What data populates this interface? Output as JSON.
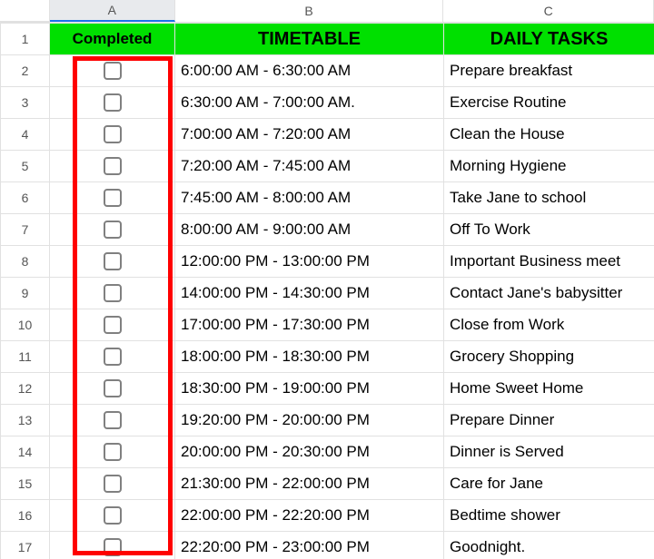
{
  "colLabels": {
    "A": "A",
    "B": "B",
    "C": "C"
  },
  "header": {
    "a": "Completed",
    "b": "TIMETABLE",
    "c": "DAILY TASKS"
  },
  "rows": [
    {
      "n": "1"
    },
    {
      "n": "2",
      "time": "6:00:00 AM - 6:30:00 AM",
      "task": "Prepare breakfast"
    },
    {
      "n": "3",
      "time": "6:30:00 AM - 7:00:00 AM.",
      "task": "Exercise Routine"
    },
    {
      "n": "4",
      "time": "7:00:00 AM - 7:20:00 AM",
      "task": "Clean the House"
    },
    {
      "n": "5",
      "time": "7:20:00 AM - 7:45:00 AM",
      "task": "Morning Hygiene"
    },
    {
      "n": "6",
      "time": "7:45:00 AM - 8:00:00 AM",
      "task": "Take Jane to school"
    },
    {
      "n": "7",
      "time": "8:00:00 AM - 9:00:00 AM",
      "task": "Off To Work"
    },
    {
      "n": "8",
      "time": "12:00:00 PM - 13:00:00 PM",
      "task": "Important Business meet"
    },
    {
      "n": "9",
      "time": "14:00:00 PM - 14:30:00 PM",
      "task": "Contact Jane's babysitter"
    },
    {
      "n": "10",
      "time": "17:00:00 PM - 17:30:00 PM",
      "task": "Close from Work"
    },
    {
      "n": "11",
      "time": "18:00:00 PM - 18:30:00 PM",
      "task": "Grocery Shopping"
    },
    {
      "n": "12",
      "time": "18:30:00 PM - 19:00:00 PM",
      "task": "Home Sweet Home"
    },
    {
      "n": "13",
      "time": "19:20:00 PM - 20:00:00 PM",
      "task": "Prepare Dinner"
    },
    {
      "n": "14",
      "time": "20:00:00 PM - 20:30:00 PM",
      "task": "Dinner is Served"
    },
    {
      "n": "15",
      "time": "21:30:00 PM - 22:00:00 PM",
      "task": "Care for Jane"
    },
    {
      "n": "16",
      "time": "22:00:00 PM - 22:20:00 PM",
      "task": "Bedtime shower"
    },
    {
      "n": "17",
      "time": "22:20:00 PM - 23:00:00 PM",
      "task": "Goodnight."
    }
  ]
}
